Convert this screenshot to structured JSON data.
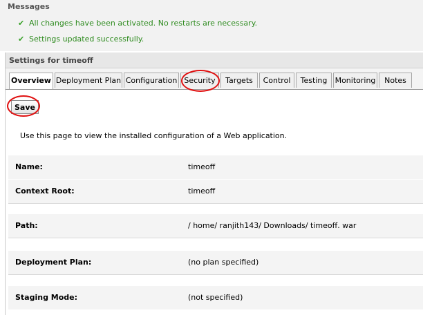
{
  "messages": {
    "title": "Messages",
    "items": [
      "All changes have been activated. No restarts are necessary.",
      "Settings updated successfully."
    ]
  },
  "settings": {
    "title": "Settings for timeoff",
    "tabs": [
      "Overview",
      "Deployment Plan",
      "Configuration",
      "Security",
      "Targets",
      "Control",
      "Testing",
      "Monitoring",
      "Notes"
    ],
    "active_tab": "Overview",
    "save_label": "Save",
    "intro": "Use this page to view the installed configuration of a Web application.",
    "fields": [
      {
        "label": "Name:",
        "value": "timeoff"
      },
      {
        "label": "Context Root:",
        "value": "timeoff"
      },
      {
        "label": "Path:",
        "value": "/ home/ ranjith143/ Downloads/ timeoff. war"
      },
      {
        "label": "Deployment Plan:",
        "value": "(no plan specified)"
      },
      {
        "label": "Staging Mode:",
        "value": "(not specified)"
      }
    ]
  },
  "colors": {
    "success_text": "#2e8b1f",
    "annotation_circle": "#e01010"
  },
  "icons": {
    "message_check": "checkmark-icon"
  }
}
